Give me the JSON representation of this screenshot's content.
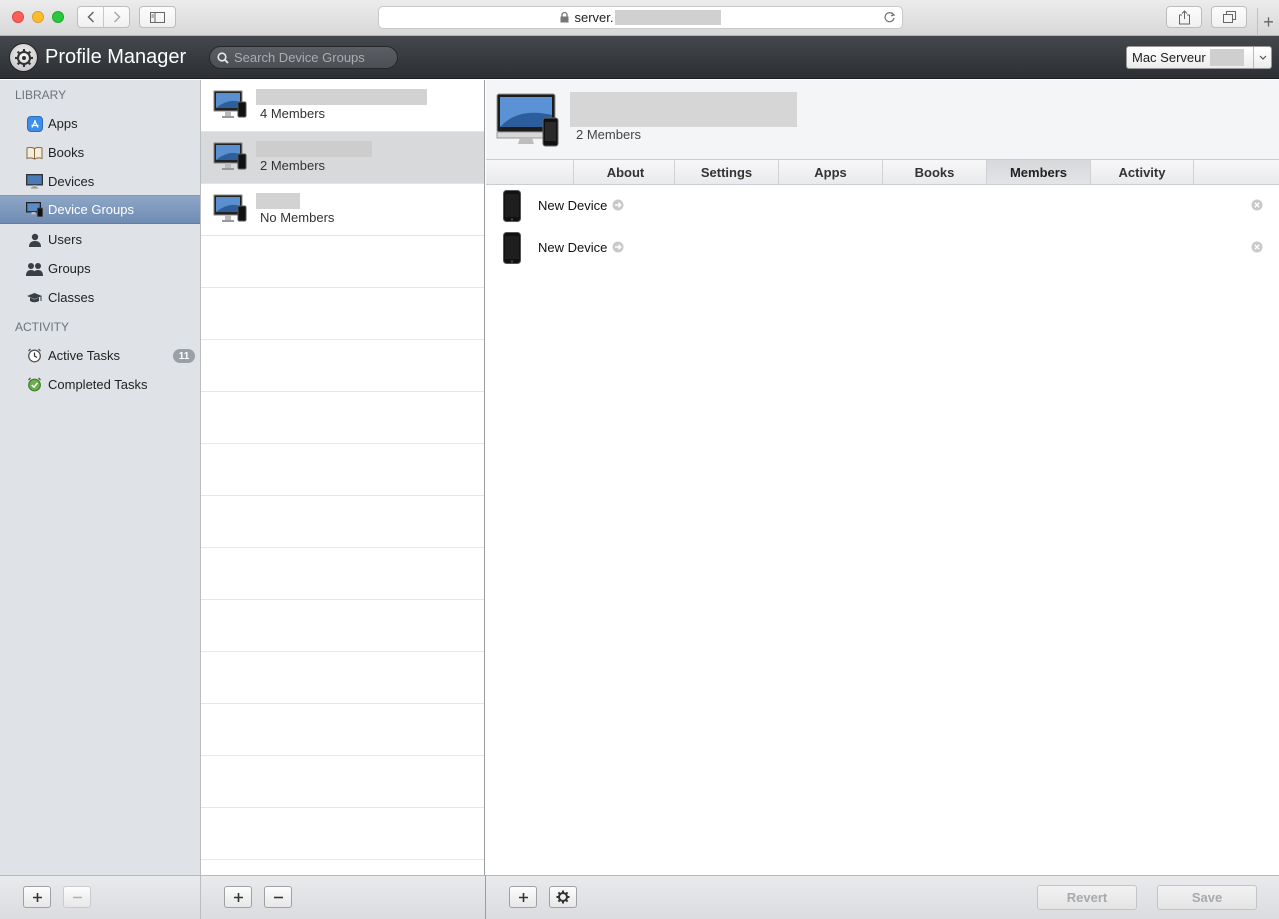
{
  "browser": {
    "url_prefix": "server.",
    "new_tab_symbol": "+"
  },
  "app": {
    "title": "Profile Manager",
    "search_placeholder": "Search Device Groups",
    "server_label": "Mac Serveur"
  },
  "sidebar": {
    "library_heading": "LIBRARY",
    "library_items": [
      {
        "label": "Apps",
        "icon": "app-store-icon"
      },
      {
        "label": "Books",
        "icon": "book-icon"
      },
      {
        "label": "Devices",
        "icon": "display-icon"
      },
      {
        "label": "Device Groups",
        "icon": "device-group-icon",
        "selected": true
      },
      {
        "label": "Users",
        "icon": "user-icon"
      },
      {
        "label": "Groups",
        "icon": "group-icon"
      },
      {
        "label": "Classes",
        "icon": "graduation-cap-icon"
      }
    ],
    "activity_heading": "ACTIVITY",
    "activity_items": [
      {
        "label": "Active Tasks",
        "icon": "clock-icon",
        "badge": "11"
      },
      {
        "label": "Completed Tasks",
        "icon": "check-clock-icon"
      }
    ],
    "add_symbol": "+",
    "remove_symbol": "−"
  },
  "group_list": {
    "rows": [
      {
        "count": "4 Members"
      },
      {
        "count": "2 Members",
        "selected": true
      },
      {
        "count": "No Members"
      }
    ],
    "add_symbol": "+",
    "remove_symbol": "−"
  },
  "detail": {
    "count": "2 Members",
    "tabs": [
      "About",
      "Settings",
      "Apps",
      "Books",
      "Members",
      "Activity"
    ],
    "selected_tab": "Members",
    "members": [
      {
        "name": "New Device"
      },
      {
        "name": "New Device"
      }
    ],
    "add_symbol": "+",
    "revert_label": "Revert",
    "save_label": "Save"
  }
}
